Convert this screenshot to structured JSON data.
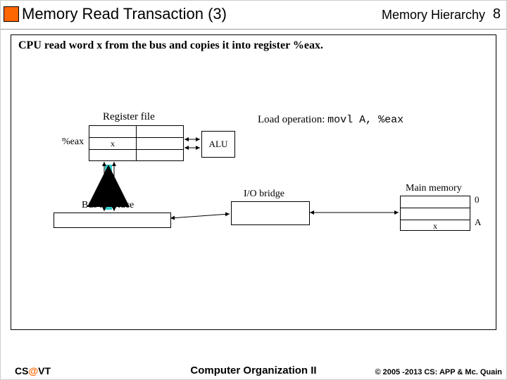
{
  "header": {
    "title": "Memory Read Transaction (3)",
    "topic": "Memory Hierarchy",
    "page": "8"
  },
  "content": {
    "description": "CPU read word x from the bus and copies it into register %eax.",
    "regfile_label": "Register file",
    "eax_label": "%eax",
    "eax_value": "x",
    "alu_label": "ALU",
    "load_op_text": "Load operation:",
    "load_op_code": "movl A, %eax",
    "io_bridge": "I/O bridge",
    "bus_interface": "Bus interface",
    "main_memory": "Main memory",
    "mem_value": "x",
    "mem_addr0": "0",
    "mem_addrA": "A"
  },
  "footer": {
    "left_cs": "CS",
    "left_at": "@",
    "left_vt": "VT",
    "center": "Computer Organization II",
    "right": "© 2005 -2013 CS: APP & Mc. Quain"
  }
}
